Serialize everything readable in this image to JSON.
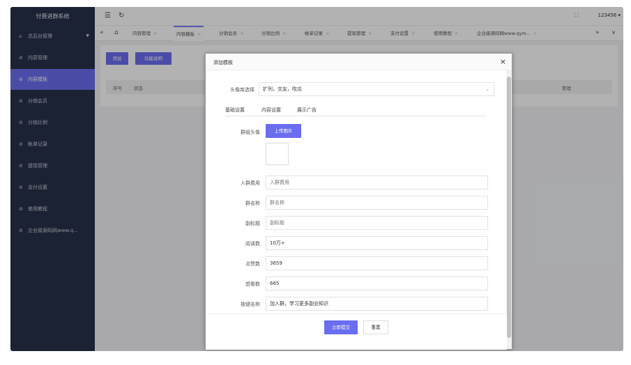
{
  "app": {
    "title": "付费进群系统",
    "user": "123456"
  },
  "sidebar": {
    "items": [
      {
        "label": "总后台管理",
        "active": false,
        "caret": true
      },
      {
        "label": "内容管理",
        "active": false
      },
      {
        "label": "内容模板",
        "active": true
      },
      {
        "label": "分销会员",
        "active": false
      },
      {
        "label": "分销比例",
        "active": false
      },
      {
        "label": "帐单记录",
        "active": false
      },
      {
        "label": "提现管理",
        "active": false
      },
      {
        "label": "支付设置",
        "active": false
      },
      {
        "label": "使用教程",
        "active": false
      },
      {
        "label": "企业级源码网www.q...",
        "active": false
      }
    ]
  },
  "tabs": [
    {
      "label": "内容管理",
      "active": false
    },
    {
      "label": "内容模板",
      "active": true
    },
    {
      "label": "分销会员",
      "active": false
    },
    {
      "label": "分销比例",
      "active": false
    },
    {
      "label": "帐单记录",
      "active": false
    },
    {
      "label": "提现管理",
      "active": false
    },
    {
      "label": "支付设置",
      "active": false
    },
    {
      "label": "使用教程",
      "active": false
    },
    {
      "label": "企业级源码网www.qym...",
      "active": false
    }
  ],
  "toolbar": {
    "add_label": "添加",
    "help_label": "功能说明"
  },
  "table": {
    "col_index": "序号",
    "col_status": "状态",
    "col_manage": "管理"
  },
  "modal": {
    "title": "添加模板",
    "avatar_lib_label": "头像库选择",
    "avatar_lib_value": "扩列，交友，吹瓜",
    "subtabs": [
      "基础设置",
      "内容设置",
      "展示广告"
    ],
    "group_avatar_label": "群组头像",
    "upload_label": "上传图片",
    "fields": [
      {
        "label": "入群费用",
        "value": "",
        "placeholder": "入群费用"
      },
      {
        "label": "群名称",
        "value": "",
        "placeholder": "群名称"
      },
      {
        "label": "副标题",
        "value": "",
        "placeholder": "副标题"
      },
      {
        "label": "阅读数",
        "value": "10万+",
        "placeholder": ""
      },
      {
        "label": "点赞数",
        "value": "3659",
        "placeholder": ""
      },
      {
        "label": "想看数",
        "value": "665",
        "placeholder": ""
      },
      {
        "label": "按键名称",
        "value": "加入群，学习更多副业知识",
        "placeholder": ""
      }
    ],
    "submit_label": "立即提交",
    "reset_label": "重置"
  },
  "colors": {
    "sidebar_bg": "#28324a",
    "accent": "#6a6df0"
  },
  "icons": {
    "menu": "menu-fold-icon",
    "refresh": "refresh-icon",
    "fullscreen": "fullscreen-icon",
    "close": "close-icon"
  }
}
